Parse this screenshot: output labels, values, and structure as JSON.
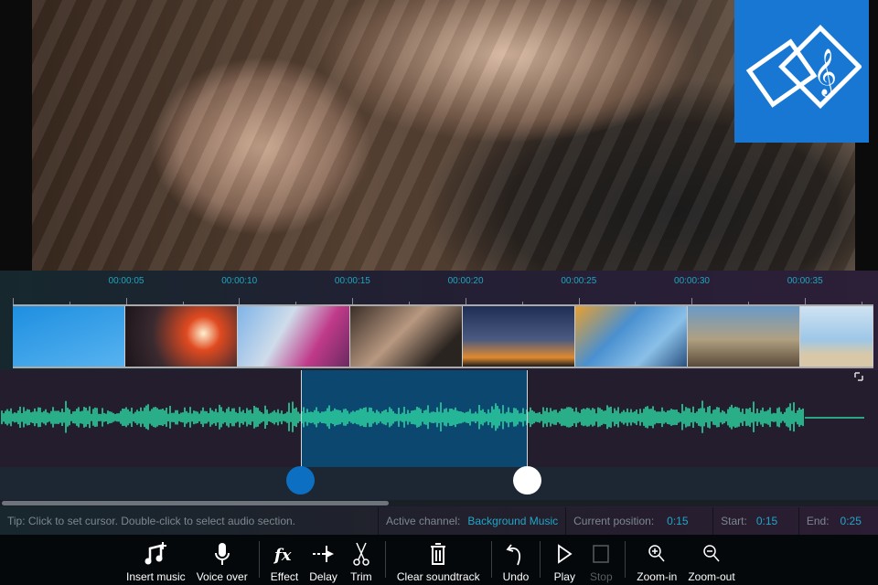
{
  "ruler": {
    "labels": [
      "00:00:05",
      "00:00:10",
      "00:00:15",
      "00:00:20",
      "00:00:25",
      "00:00:30",
      "00:00:35"
    ]
  },
  "thumbnails": [
    "airshow",
    "concert",
    "monorail",
    "woman",
    "ferris-wheel",
    "glass-house",
    "space-needle",
    "beach"
  ],
  "status": {
    "tip": "Tip: Click to set cursor. Double-click to select audio section.",
    "active_channel_label": "Active channel:",
    "active_channel": "Background Music",
    "position_label": "Current position:",
    "position": "0:15",
    "start_label": "Start:",
    "start": "0:15",
    "end_label": "End:",
    "end": "0:25"
  },
  "toolbar": {
    "insert_music": "Insert music",
    "voice_over": "Voice over",
    "effect": "Effect",
    "delay": "Delay",
    "trim": "Trim",
    "clear": "Clear soundtrack",
    "undo": "Undo",
    "play": "Play",
    "stop": "Stop",
    "zoom_in": "Zoom-in",
    "zoom_out": "Zoom-out"
  },
  "colors": {
    "accent": "#1fa6c8",
    "wave": "#2bd3a0",
    "logo": "#1877d2",
    "selection": "#0c4770"
  }
}
